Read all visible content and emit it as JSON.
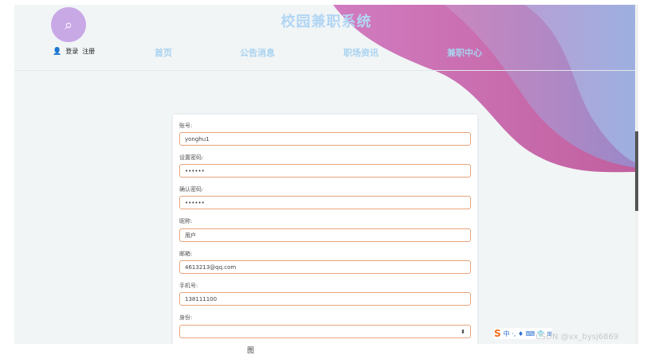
{
  "header": {
    "site_title": "校园兼职系统",
    "login_label": "登录",
    "register_label": "注册",
    "nav": [
      "首页",
      "公告消息",
      "职场资讯",
      "兼职中心"
    ]
  },
  "form": {
    "fields": [
      {
        "label": "账号:",
        "value": "yonghu1"
      },
      {
        "label": "设置密码:",
        "value": "••••••"
      },
      {
        "label": "确认密码:",
        "value": "••••••"
      },
      {
        "label": "昵称:",
        "value": "用户"
      },
      {
        "label": "邮箱:",
        "value": "4613213@qq.com"
      },
      {
        "label": "手机号:",
        "value": "138111100"
      },
      {
        "label": "身份:",
        "value": ""
      }
    ]
  },
  "ime": {
    "logo": "S",
    "items": "中 ·, ♦ ⌨ 👕 ⊞"
  },
  "watermark": "CSDN @vx_bysj6869",
  "caption": "图"
}
